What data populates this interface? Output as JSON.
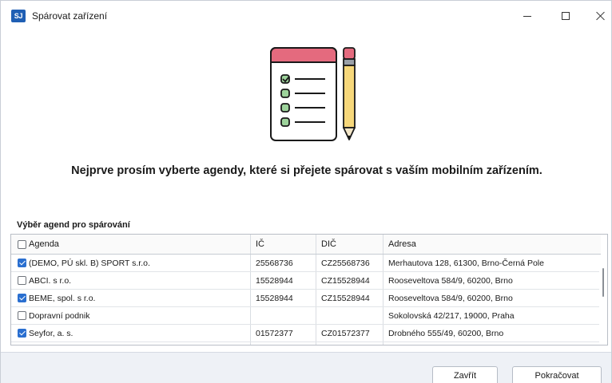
{
  "window": {
    "app_icon_text": "SJ",
    "title": "Spárovat zařízení",
    "accent_color": "#1f5fb4"
  },
  "headline": "Nejprve prosím vyberte agendy, které si přejete spárovat s vaším mobilním zařízením.",
  "section_label": "Výběr agend pro spárování",
  "table": {
    "columns": [
      "Agenda",
      "IČ",
      "DIČ",
      "Adresa"
    ],
    "header_checked": false,
    "rows": [
      {
        "checked": true,
        "agenda": "(DEMO, PÚ skl. B) SPORT s.r.o.",
        "ic": "25568736",
        "dic": "CZ25568736",
        "adresa": "Merhautova 128, 61300, Brno-Černá Pole"
      },
      {
        "checked": false,
        "agenda": "ABCI. s r.o.",
        "ic": "15528944",
        "dic": "CZ15528944",
        "adresa": "Rooseveltova 584/9, 60200, Brno"
      },
      {
        "checked": true,
        "agenda": "BEME, spol. s r.o.",
        "ic": "15528944",
        "dic": "CZ15528944",
        "adresa": "Rooseveltova 584/9, 60200, Brno"
      },
      {
        "checked": false,
        "agenda": "Dopravní podnik",
        "ic": "",
        "dic": "",
        "adresa": "Sokolovská 42/217, 19000, Praha"
      },
      {
        "checked": true,
        "agenda": "Seyfor, a. s.",
        "ic": "01572377",
        "dic": "CZ01572377",
        "adresa": "Drobného 555/49, 60200, Brno"
      }
    ]
  },
  "footer": {
    "close_label": "Zavřít",
    "continue_label": "Pokračovat"
  },
  "icons": {
    "illustration": "checklist-with-pencil-icon",
    "checkbox_checked_color": "#2a6fd0"
  }
}
